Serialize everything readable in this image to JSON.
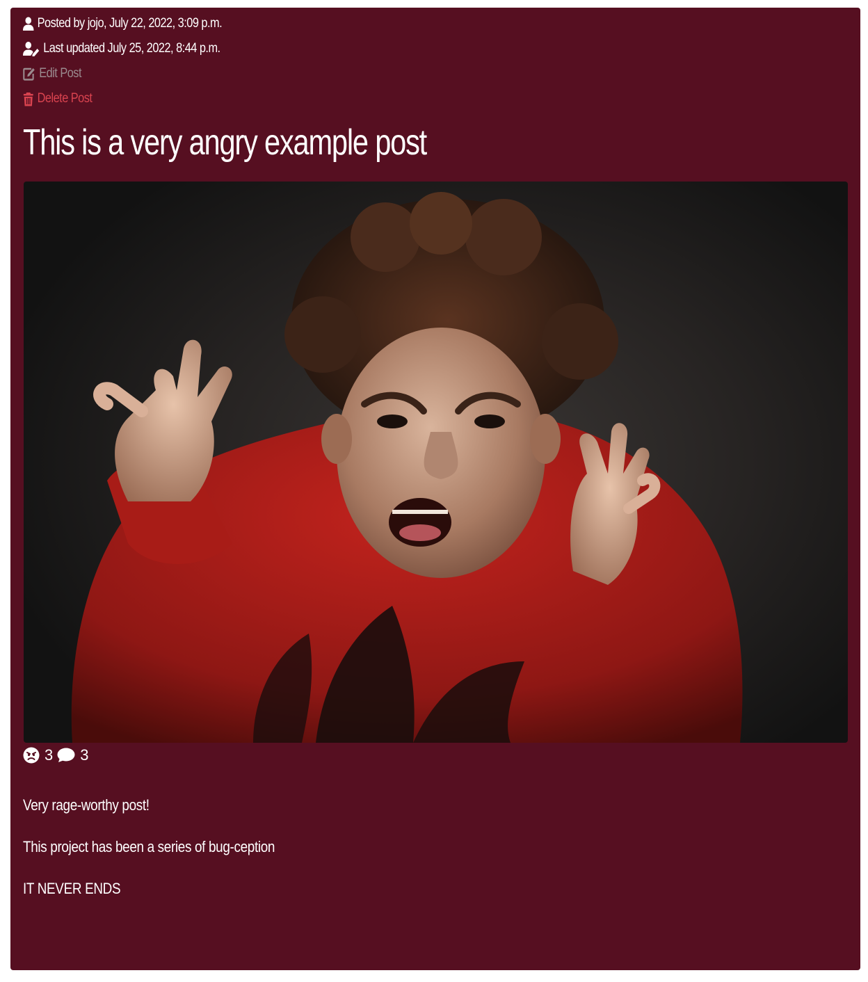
{
  "post": {
    "posted_by": "Posted by jojo, July 22, 2022, 3:09 p.m.",
    "last_updated": "Last updated July 25, 2022, 8:44 p.m.",
    "edit_label": "Edit Post",
    "delete_label": "Delete Post",
    "title": "This is a very angry example post",
    "image_alt": "Angry child in a red sweatshirt screaming with raised hands",
    "angry_count": "3",
    "comment_count": "3",
    "content": [
      "Very rage-worthy post!",
      "This project has been a series of bug-ception",
      "IT NEVER ENDS"
    ]
  },
  "icons": {
    "posted_by": "user-icon",
    "last_updated": "user-pen-icon",
    "edit": "edit-icon",
    "delete": "trash-icon",
    "angry": "angry-face-icon",
    "comment": "comment-icon"
  },
  "colors": {
    "card_background": "#560f21",
    "text": "#ffffff",
    "edit_link": "#9a8a8e",
    "delete_link": "#d9434f"
  }
}
